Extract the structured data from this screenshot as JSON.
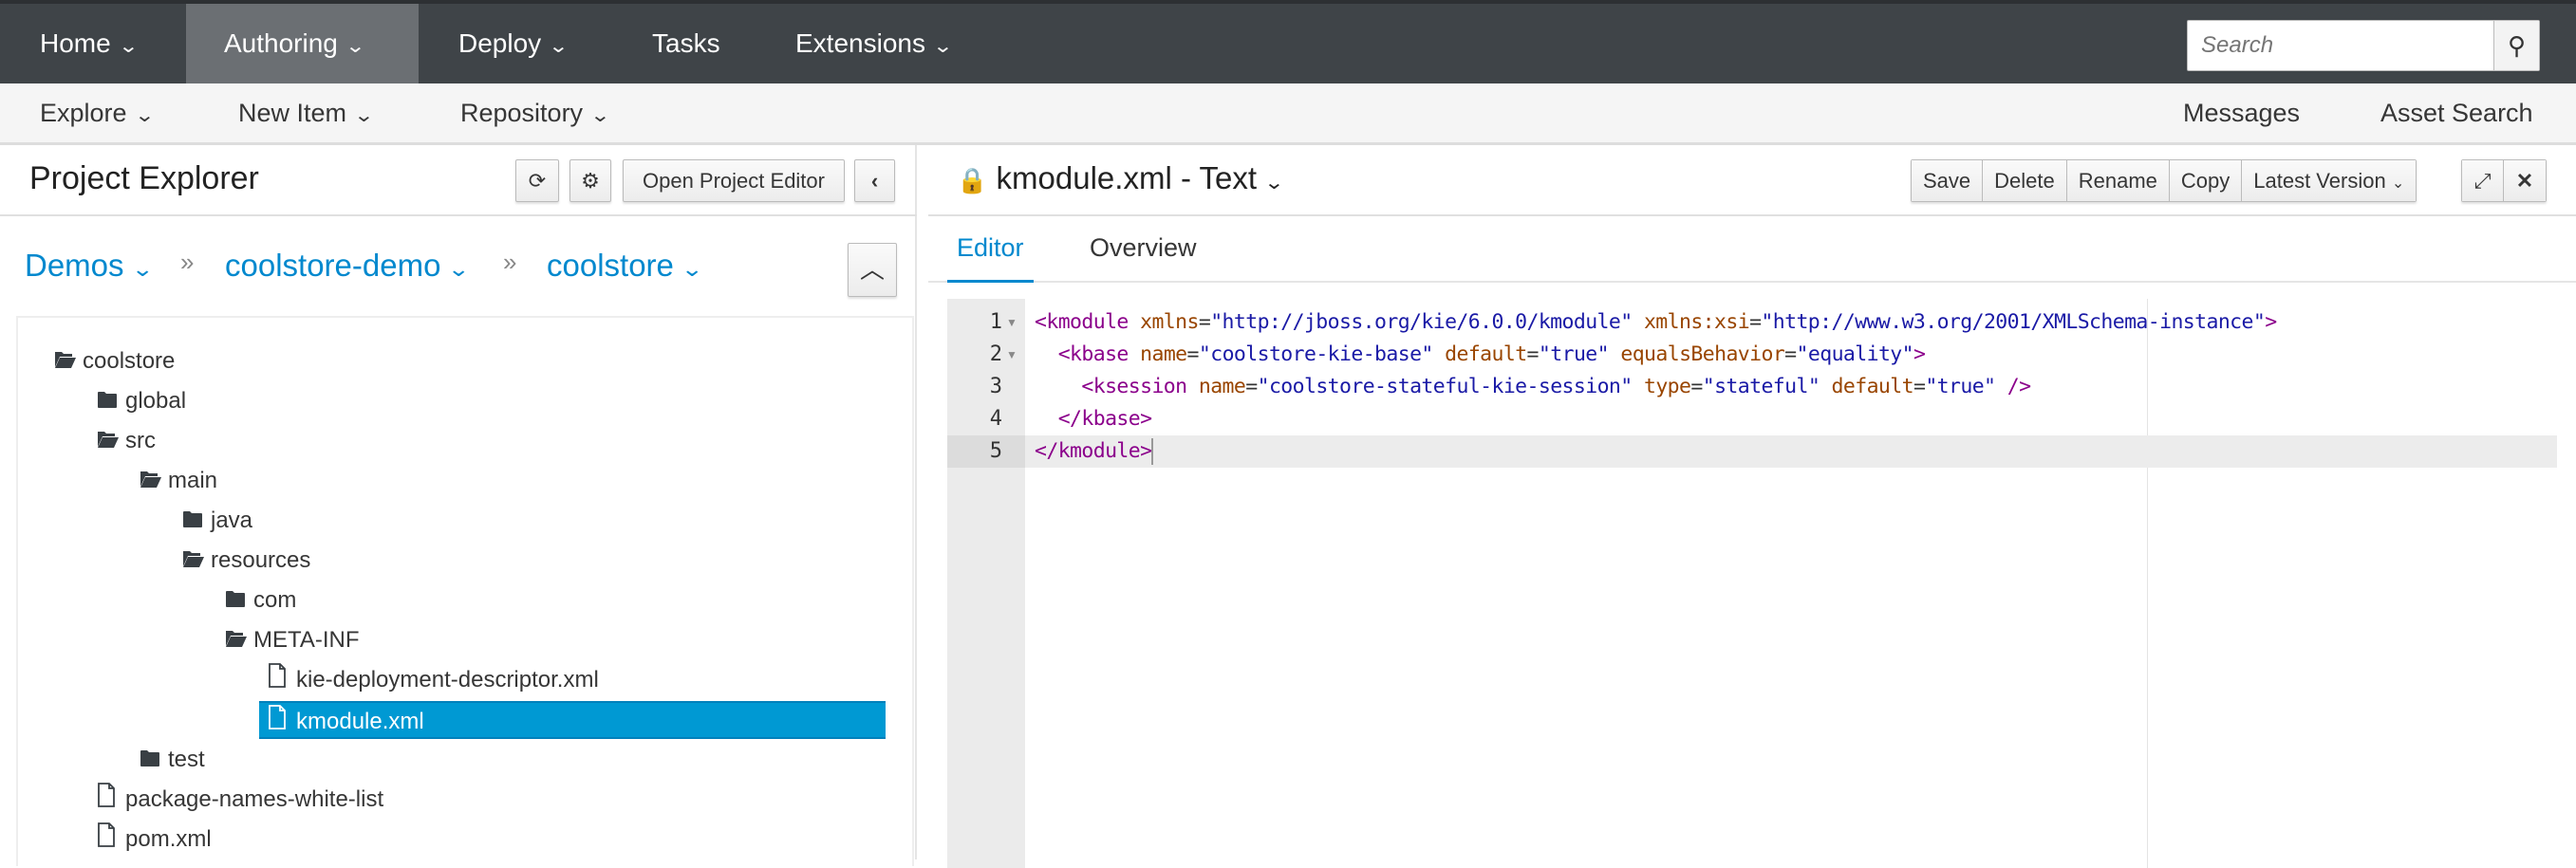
{
  "topnav": {
    "items": [
      {
        "label": "Home",
        "dropdown": true
      },
      {
        "label": "Authoring",
        "dropdown": true,
        "active": true
      },
      {
        "label": "Deploy",
        "dropdown": true
      },
      {
        "label": "Tasks",
        "dropdown": false
      },
      {
        "label": "Extensions",
        "dropdown": true
      }
    ],
    "search": {
      "placeholder": "Search",
      "icon": "search-icon"
    }
  },
  "subnav": {
    "left": [
      {
        "label": "Explore"
      },
      {
        "label": "New Item"
      },
      {
        "label": "Repository"
      }
    ],
    "right": [
      {
        "label": "Messages"
      },
      {
        "label": "Asset Search"
      }
    ]
  },
  "explorer": {
    "title": "Project Explorer",
    "open_editor": "Open Project Editor",
    "breadcrumb": [
      "Demos",
      "coolstore-demo",
      "coolstore"
    ],
    "breadcrumb_sep": "»",
    "tree": [
      {
        "label": "coolstore",
        "type": "folder-open",
        "depth": 0
      },
      {
        "label": "global",
        "type": "folder",
        "depth": 1
      },
      {
        "label": "src",
        "type": "folder-open",
        "depth": 1
      },
      {
        "label": "main",
        "type": "folder-open",
        "depth": 2
      },
      {
        "label": "java",
        "type": "folder",
        "depth": 3
      },
      {
        "label": "resources",
        "type": "folder-open",
        "depth": 3
      },
      {
        "label": "com",
        "type": "folder",
        "depth": 4
      },
      {
        "label": "META-INF",
        "type": "folder-open",
        "depth": 4
      },
      {
        "label": "kie-deployment-descriptor.xml",
        "type": "file",
        "depth": 5
      },
      {
        "label": "kmodule.xml",
        "type": "file",
        "depth": 5,
        "selected": true
      },
      {
        "label": "test",
        "type": "folder",
        "depth": 2
      },
      {
        "label": "package-names-white-list",
        "type": "file",
        "depth": 1
      },
      {
        "label": "pom.xml",
        "type": "file",
        "depth": 1
      }
    ]
  },
  "editor": {
    "title": "kmodule.xml - Text",
    "buttons": [
      "Save",
      "Delete",
      "Rename",
      "Copy",
      "Latest Version"
    ],
    "tabs": [
      {
        "label": "Editor",
        "active": true
      },
      {
        "label": "Overview"
      }
    ],
    "active_line": 5,
    "lines": [
      {
        "n": "1",
        "fold": true,
        "tokens": [
          [
            "t",
            "<kmodule "
          ],
          [
            "a",
            "xmlns"
          ],
          [
            "p",
            "="
          ],
          [
            "v",
            "\"http://jboss.org/kie/6.0.0/kmodule\""
          ],
          [
            "p",
            " "
          ],
          [
            "a",
            "xmlns:xsi"
          ],
          [
            "p",
            "="
          ],
          [
            "v",
            "\"http://www.w3.org/2001/XMLSchema-instance\""
          ],
          [
            "t",
            ">"
          ]
        ]
      },
      {
        "n": "2",
        "fold": true,
        "tokens": [
          [
            "p",
            "  "
          ],
          [
            "t",
            "<kbase "
          ],
          [
            "a",
            "name"
          ],
          [
            "p",
            "="
          ],
          [
            "v",
            "\"coolstore-kie-base\""
          ],
          [
            "p",
            " "
          ],
          [
            "a",
            "default"
          ],
          [
            "p",
            "="
          ],
          [
            "v",
            "\"true\""
          ],
          [
            "p",
            " "
          ],
          [
            "a",
            "equalsBehavior"
          ],
          [
            "p",
            "="
          ],
          [
            "v",
            "\"equality\""
          ],
          [
            "t",
            ">"
          ]
        ]
      },
      {
        "n": "3",
        "fold": false,
        "tokens": [
          [
            "p",
            "    "
          ],
          [
            "t",
            "<ksession "
          ],
          [
            "a",
            "name"
          ],
          [
            "p",
            "="
          ],
          [
            "v",
            "\"coolstore-stateful-kie-session\""
          ],
          [
            "p",
            " "
          ],
          [
            "a",
            "type"
          ],
          [
            "p",
            "="
          ],
          [
            "v",
            "\"stateful\""
          ],
          [
            "p",
            " "
          ],
          [
            "a",
            "default"
          ],
          [
            "p",
            "="
          ],
          [
            "v",
            "\"true\""
          ],
          [
            "p",
            " "
          ],
          [
            "t",
            "/>"
          ]
        ]
      },
      {
        "n": "4",
        "fold": false,
        "tokens": [
          [
            "p",
            "  "
          ],
          [
            "t",
            "</kbase>"
          ]
        ]
      },
      {
        "n": "5",
        "fold": false,
        "tokens": [
          [
            "t",
            "</kmodule>"
          ]
        ]
      }
    ]
  },
  "colors": {
    "navbar": "#3f4448",
    "active_nav": "#6b6f73",
    "link": "#0088ce",
    "selection": "#0099d3"
  }
}
